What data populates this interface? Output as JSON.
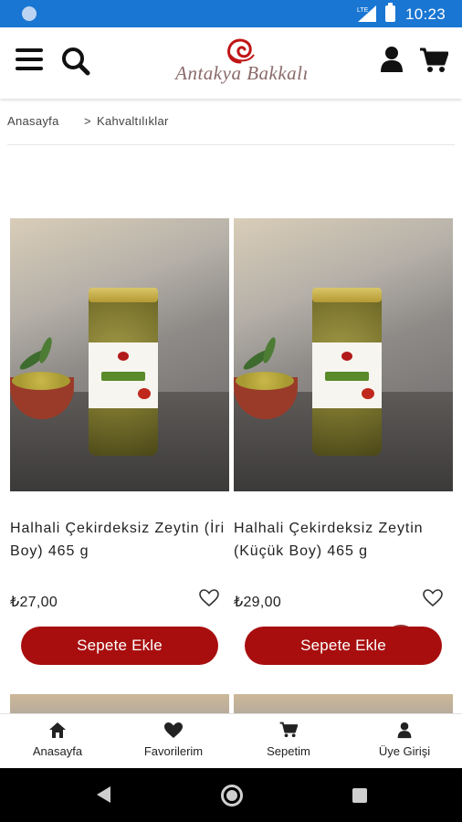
{
  "status_bar": {
    "time": "10:23",
    "network": "LTE"
  },
  "header": {
    "logo_text": "Antakya Bakkalı",
    "icons": [
      "menu-icon",
      "search-icon",
      "user-icon",
      "cart-icon"
    ]
  },
  "breadcrumb": {
    "home": "Anasayfa",
    "separator": ">",
    "current": "Kahvaltılıklar"
  },
  "products": [
    {
      "name": "Halhali Çekirdeksiz Zeytin (İri Boy) 465 g",
      "price": "₺27,00",
      "button_label": "Sepete Ekle"
    },
    {
      "name": "Halhali Çekirdeksiz Zeytin (Küçük Boy) 465 g",
      "price": "₺29,00",
      "button_label": "Sepete Ekle"
    }
  ],
  "bottom_nav": {
    "items": [
      {
        "label": "Anasayfa",
        "icon": "home-icon"
      },
      {
        "label": "Favorilerim",
        "icon": "heart-icon"
      },
      {
        "label": "Sepetim",
        "icon": "cart-icon"
      },
      {
        "label": "Üye Girişi",
        "icon": "user-icon"
      }
    ]
  },
  "colors": {
    "status_bar": "#1976d2",
    "accent": "#a80e0e",
    "text": "#222222"
  }
}
